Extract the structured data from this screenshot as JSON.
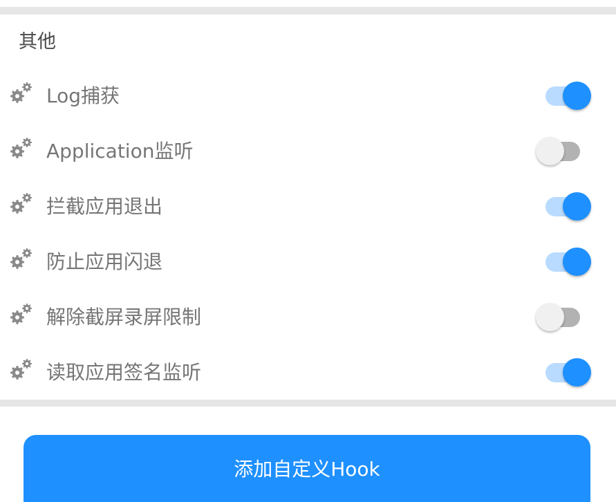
{
  "section": {
    "title": "其他"
  },
  "settings": [
    {
      "label": "Log捕获",
      "enabled": true,
      "icon": "gears-icon"
    },
    {
      "label": "Application监听",
      "enabled": false,
      "icon": "gears-icon"
    },
    {
      "label": "拦截应用退出",
      "enabled": true,
      "icon": "gears-icon"
    },
    {
      "label": "防止应用闪退",
      "enabled": true,
      "icon": "gears-icon"
    },
    {
      "label": "解除截屏录屏限制",
      "enabled": false,
      "icon": "gears-icon"
    },
    {
      "label": "读取应用签名监听",
      "enabled": true,
      "icon": "gears-icon"
    }
  ],
  "actions": {
    "add_hook_label": "添加自定义Hook"
  },
  "colors": {
    "accent": "#1e90ff",
    "switch_track_on": "#b8dbff",
    "switch_track_off": "#b2b2b2",
    "switch_thumb_off": "#f0f0f0",
    "divider": "#e6e6e6",
    "label_text": "#757575",
    "icon": "#8a8a8a"
  }
}
